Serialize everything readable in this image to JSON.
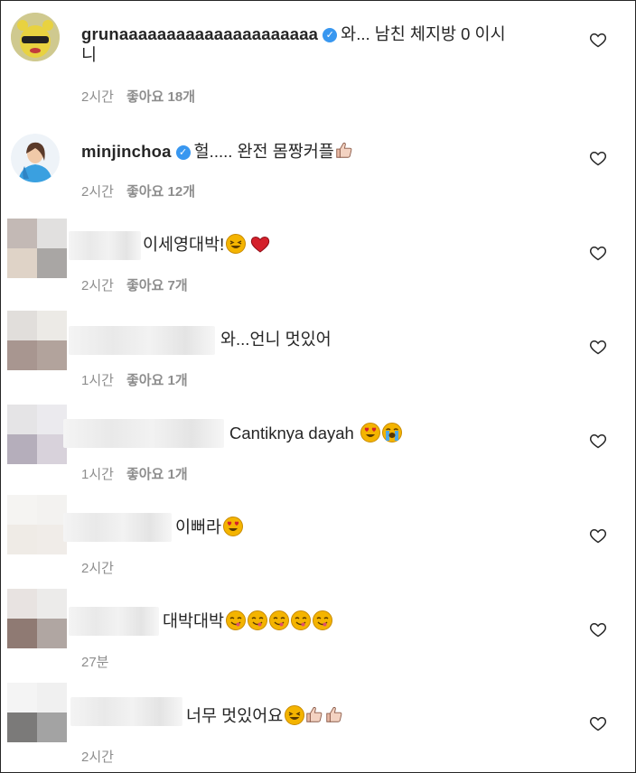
{
  "comments": [
    {
      "username": "grunaaaaaaaaaaaaaaaaaaaaa",
      "verified": true,
      "text_line1": "와... 남친 체지방 0 이시",
      "text_line2": "니",
      "time": "2시간",
      "likes": "좋아요 18개"
    },
    {
      "username": "minjinchoa",
      "verified": true,
      "text": "헐..... 완전 몸짱커플",
      "emojis": [
        "thumbs-up"
      ],
      "time": "2시간",
      "likes": "좋아요 12개"
    },
    {
      "text": "이세영대박!",
      "emojis": [
        "grinning-squint",
        "red-heart"
      ],
      "time": "2시간",
      "likes": "좋아요 7개"
    },
    {
      "text": "와...언니 멋있어",
      "time": "1시간",
      "likes": "좋아요 1개"
    },
    {
      "text": "Cantiknya dayah",
      "emojis": [
        "heart-eyes",
        "loudly-crying"
      ],
      "time": "1시간",
      "likes": "좋아요 1개"
    },
    {
      "text": "이뻐라",
      "emojis": [
        "heart-eyes"
      ],
      "time": "2시간"
    },
    {
      "text": "대박대박",
      "emojis": [
        "yum",
        "yum",
        "yum",
        "yum",
        "yum"
      ],
      "time": "27분"
    },
    {
      "text": "너무 멋있어요",
      "emojis": [
        "grinning-squint",
        "thumbs-up",
        "thumbs-up"
      ],
      "time": "2시간"
    }
  ],
  "icons": {
    "like": "heart-outline-icon",
    "verified": "verified-badge-icon"
  },
  "colors": {
    "text": "#262626",
    "meta": "#8e8e8e",
    "verified": "#3897f0",
    "heart": "#e0245e"
  }
}
